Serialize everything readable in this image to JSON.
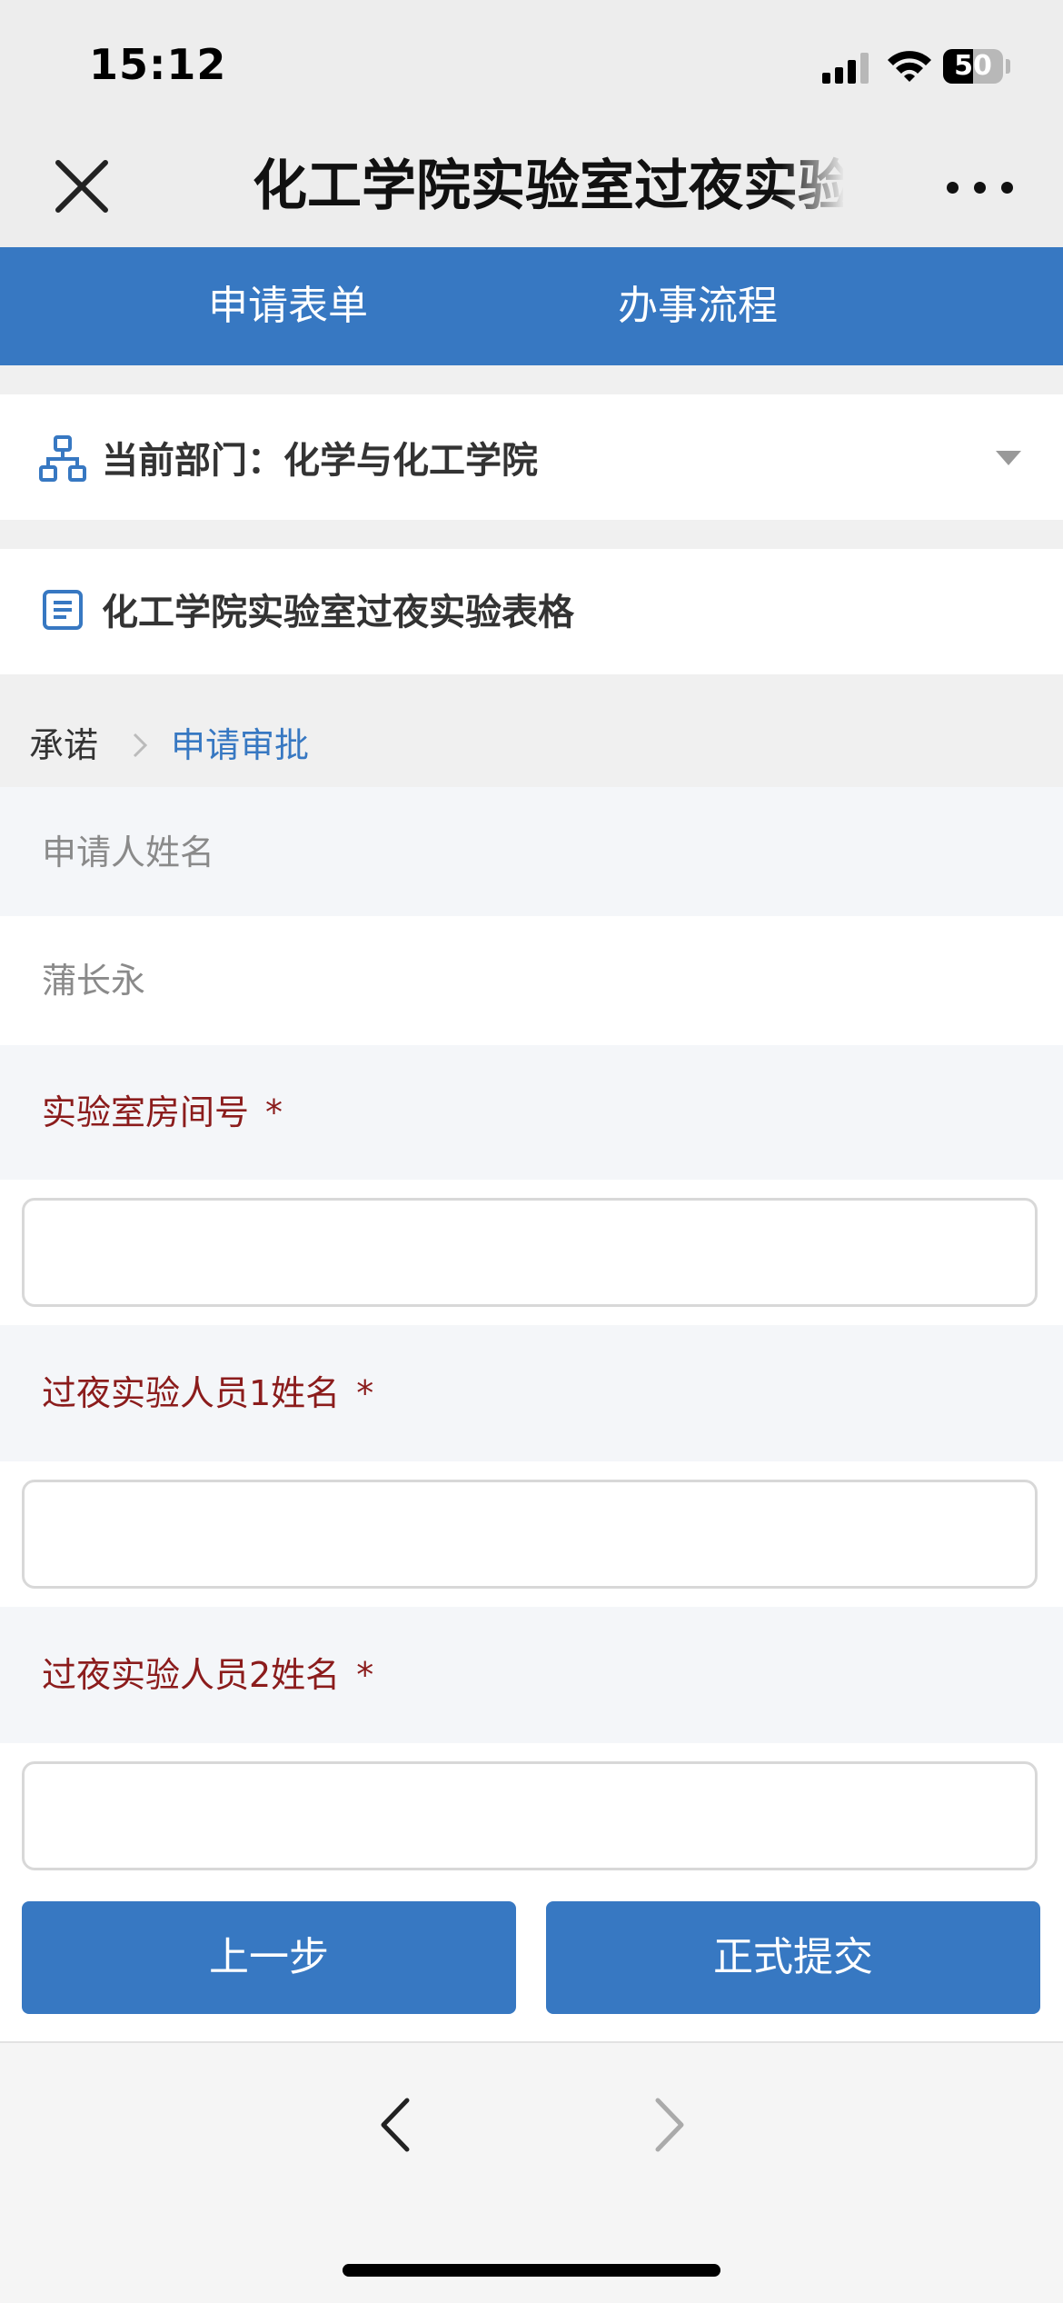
{
  "status_bar": {
    "time": "15:12",
    "battery": "50"
  },
  "nav": {
    "title": "化工学院实验室过夜实验"
  },
  "tabs": [
    {
      "label": "申请表单"
    },
    {
      "label": "办事流程"
    }
  ],
  "department": {
    "text": "当前部门：化学与化工学院"
  },
  "form": {
    "title": "化工学院实验室过夜实验表格"
  },
  "breadcrumb": {
    "step1": "承诺",
    "step2": "申请审批"
  },
  "fields": {
    "applicant_label": "申请人姓名",
    "applicant_value": "蒲长永",
    "room_label": "实验室房间号",
    "person1_label": "过夜实验人员1姓名",
    "person2_label": "过夜实验人员2姓名",
    "required_mark": "*"
  },
  "buttons": {
    "prev": "上一步",
    "submit": "正式提交"
  },
  "colors": {
    "accent": "#3778c2",
    "required": "#8b1c1c"
  }
}
